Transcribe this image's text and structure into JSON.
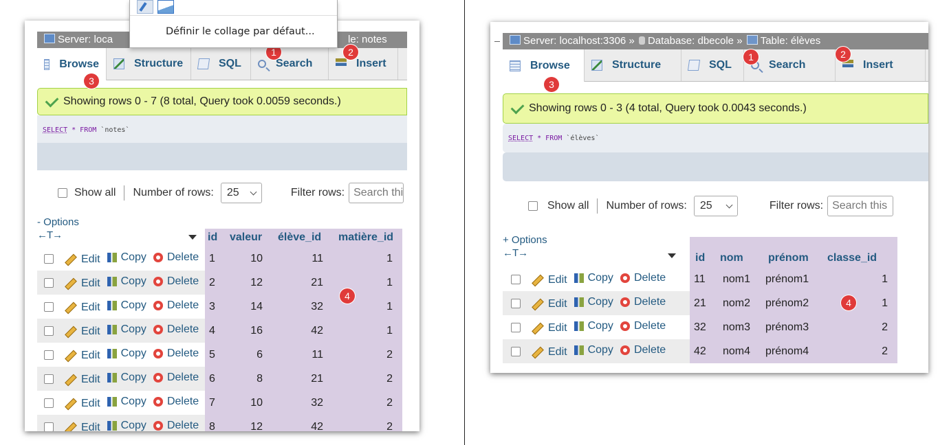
{
  "left": {
    "breadcrumb": {
      "server": "Server: loca",
      "table": "le: notes"
    },
    "tabs": [
      {
        "label": "Browse",
        "icon": "browse-icon"
      },
      {
        "label": "Structure",
        "icon": "structure-icon"
      },
      {
        "label": "SQL",
        "icon": "sql-icon"
      },
      {
        "label": "Search",
        "icon": "search-icon"
      },
      {
        "label": "Insert",
        "icon": "insert-icon"
      }
    ],
    "markers": {
      "m1": "1",
      "m2": "2",
      "m3": "3",
      "m4": "4"
    },
    "success": "Showing rows 0 - 7 (8 total, Query took 0.0059 seconds.)",
    "sql": {
      "select": "SELECT",
      "rest": " * FROM ",
      "table": "`notes`"
    },
    "controls": {
      "show_all": "Show all",
      "rows_label": "Number of rows:",
      "rows_value": "25",
      "filter_label": "Filter rows:",
      "filter_placeholder": "Search thi"
    },
    "options_label": "- Options",
    "arrows": "←T→",
    "actions": {
      "edit": "Edit",
      "copy": "Copy",
      "delete": "Delete"
    },
    "columns": [
      "id",
      "valeur",
      "élève_id",
      "matière_id"
    ],
    "rows": [
      [
        "1",
        "10",
        "11",
        "1"
      ],
      [
        "2",
        "12",
        "21",
        "1"
      ],
      [
        "3",
        "14",
        "32",
        "1"
      ],
      [
        "4",
        "16",
        "42",
        "1"
      ],
      [
        "5",
        "6",
        "11",
        "2"
      ],
      [
        "6",
        "8",
        "21",
        "2"
      ],
      [
        "7",
        "10",
        "32",
        "2"
      ],
      [
        "8",
        "12",
        "42",
        "2"
      ]
    ],
    "context_menu": {
      "item": "Définir le collage par défaut..."
    }
  },
  "right": {
    "breadcrumb": {
      "server": "Server: localhost:3306 »",
      "database": "Database: dbecole »",
      "table": "Table: élèves"
    },
    "tabs": [
      {
        "label": "Browse",
        "icon": "browse-icon"
      },
      {
        "label": "Structure",
        "icon": "structure-icon"
      },
      {
        "label": "SQL",
        "icon": "sql-icon"
      },
      {
        "label": "Search",
        "icon": "search-icon"
      },
      {
        "label": "Insert",
        "icon": "insert-icon"
      }
    ],
    "markers": {
      "m1": "1",
      "m2": "2",
      "m3": "3",
      "m4": "4"
    },
    "success": "Showing rows 0 - 3 (4 total, Query took 0.0043 seconds.)",
    "sql": {
      "select": "SELECT",
      "rest": " * FROM ",
      "table": "`élèves`"
    },
    "controls": {
      "show_all": "Show all",
      "rows_label": "Number of rows:",
      "rows_value": "25",
      "filter_label": "Filter rows:",
      "filter_placeholder": "Search this"
    },
    "options_label": "+ Options",
    "arrows": "←T→",
    "actions": {
      "edit": "Edit",
      "copy": "Copy",
      "delete": "Delete"
    },
    "columns": [
      "id",
      "nom",
      "prénom",
      "classe_id"
    ],
    "rows": [
      [
        "11",
        "nom1",
        "prénom1",
        "1"
      ],
      [
        "21",
        "nom2",
        "prénom2",
        "1"
      ],
      [
        "32",
        "nom3",
        "prénom3",
        "2"
      ],
      [
        "42",
        "nom4",
        "prénom4",
        "2"
      ]
    ]
  },
  "colors": {
    "link": "#235a81",
    "highlight": "#d9cde3",
    "success_bg": "#ebf8a4",
    "marker": "#e03a3a"
  }
}
